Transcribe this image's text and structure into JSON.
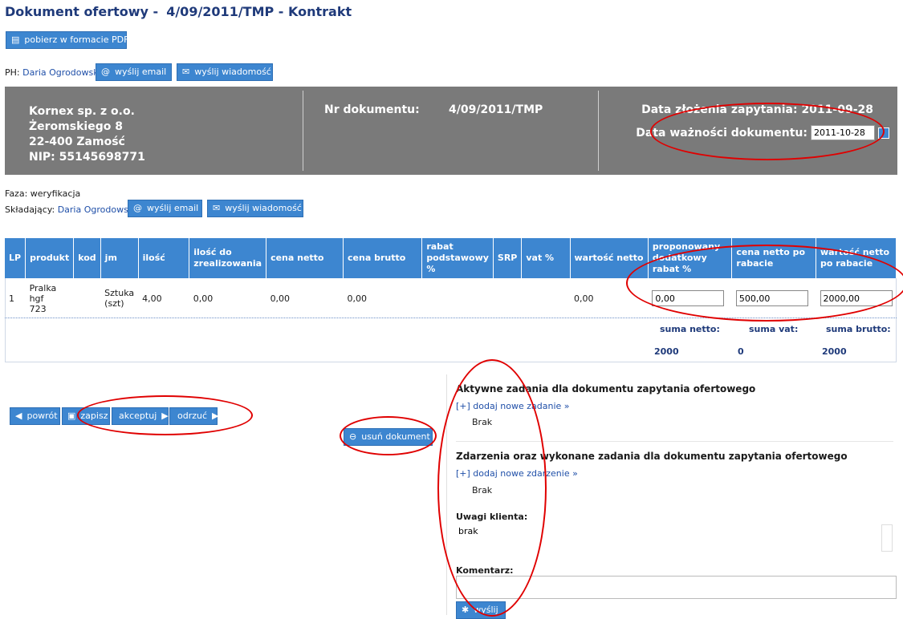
{
  "page": {
    "title_prefix": "Dokument ofertowy -",
    "title_doc": "4/09/2011/TMP - Kontrakt"
  },
  "toolbar": {
    "pdf_label": "pobierz w formacie PDF"
  },
  "ph": {
    "label": "PH:",
    "name": "Daria Ogrodowska",
    "email_label": "wyślij email",
    "msg_label": "wyślij wiadomość"
  },
  "header": {
    "company": "Kornex sp. z o.o.",
    "street": "Żeromskiego 8",
    "city": "22-400 Zamość",
    "nip": "NIP: 55145698771",
    "nr_label": "Nr dokumentu:",
    "nr_value": "4/09/2011/TMP",
    "date_submit_label": "Data złożenia zapytania:",
    "date_submit_value": "2011-09-28",
    "date_valid_label": "Data ważności dokumentu:",
    "date_valid_value": "2011-10-28"
  },
  "status": {
    "faza_label": "Faza:",
    "faza_value": "weryfikacja",
    "skl_label": "Składający:",
    "skl_name": "Daria Ogrodowska",
    "email_label": "wyślij email",
    "msg_label": "wyślij wiadomość"
  },
  "table": {
    "headers": [
      "LP",
      "produkt",
      "kod",
      "jm",
      "ilość",
      "ilość do zrealizowania",
      "cena netto",
      "cena brutto",
      "rabat podstawowy %",
      "SRP",
      "vat %",
      "wartość netto",
      "proponowany dodatkowy rabat %",
      "cena netto po rabacie",
      "wartość netto po rabacie"
    ],
    "rows": [
      {
        "lp": "1",
        "produkt": [
          "Pralka",
          "hgf",
          "723"
        ],
        "kod": "",
        "jm": [
          "Sztuka",
          "(szt)"
        ],
        "ilosc": "4,00",
        "ilosc_do_zreal": "0,00",
        "cena_netto": "0,00",
        "cena_brutto": "0,00",
        "rabat_podst": "",
        "srp": "",
        "vat": "",
        "wartosc_netto": "0,00",
        "rabat_dod": "0,00",
        "cena_po_rabacie": "500,00",
        "wartosc_po_rabacie": "2000,00"
      }
    ],
    "sum_netto_label": "suma netto:",
    "sum_vat_label": "suma vat:",
    "sum_brutto_label": "suma brutto:",
    "sum_netto": "2000",
    "sum_vat": "0",
    "sum_brutto": "2000"
  },
  "actions": {
    "back": "powrót",
    "save": "zapisz",
    "accept": "akceptuj",
    "reject": "odrzuć",
    "delete": "usuń dokument"
  },
  "right": {
    "active_tasks_title": "Aktywne zadania dla dokumentu zapytania ofertowego",
    "add_task": "[+] dodaj nowe zadanie »",
    "tasks_none": "Brak",
    "events_title": "Zdarzenia oraz wykonane zadania dla dokumentu zapytania ofertowego",
    "add_event": "[+] dodaj nowe zdarzenie »",
    "events_none": "Brak",
    "remarks_label": "Uwagi klienta:",
    "remarks_value": "brak",
    "comment_label": "Komentarz:",
    "send_label": "wyślij"
  },
  "icons": [
    "pdf-icon",
    "email-icon",
    "message-icon",
    "calendar-icon",
    "arrow-left-icon",
    "floppy-icon",
    "arrow-right-icon",
    "minus-circle-icon",
    "send-icon"
  ],
  "colors": {
    "accent": "#3d86d0",
    "title": "#1f3a7a",
    "header_bg": "#7a7a7a",
    "annotation": "#e00000"
  }
}
